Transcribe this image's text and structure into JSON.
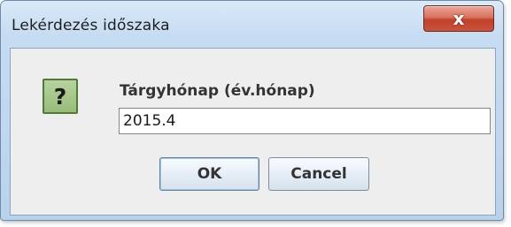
{
  "window": {
    "title": "Lekérdezés időszaka",
    "close_label": "x"
  },
  "dialog": {
    "icon": "question-icon",
    "icon_glyph": "?",
    "field_label": "Tárgyhónap (év.hónap)",
    "field_value": "2015.4"
  },
  "buttons": {
    "ok_label": "OK",
    "cancel_label": "Cancel"
  },
  "colors": {
    "close_button": "#c8533b",
    "icon_background": "#a7c98b",
    "content_background": "#eeeeee"
  }
}
